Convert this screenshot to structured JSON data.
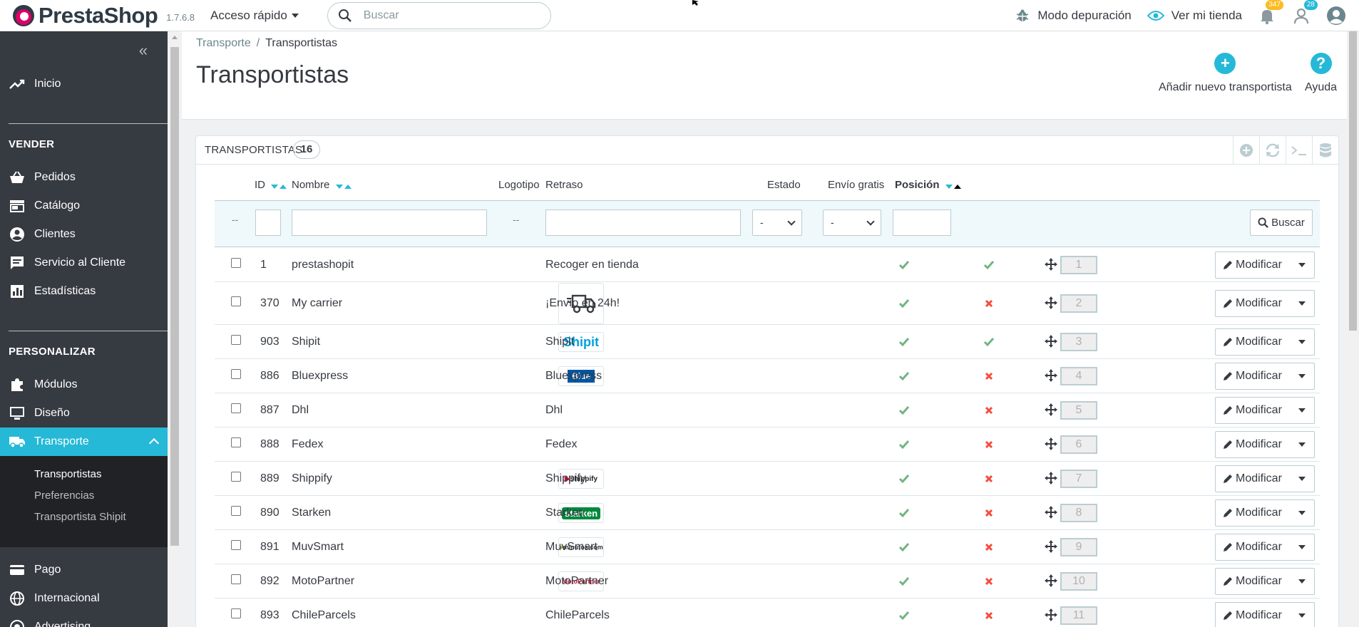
{
  "header": {
    "brand": "PrestaShop",
    "version": "1.7.6.8",
    "quick_access": "Acceso rápido",
    "search_placeholder": "Buscar",
    "debug_mode": "Modo depuración",
    "view_shop": "Ver mi tienda",
    "orders_badge": "347",
    "customers_badge": "28",
    "colors": {
      "accent": "#25b9d7",
      "orders_badge": "#fbbb22",
      "customers_badge": "#25b9d7"
    }
  },
  "sidebar": {
    "home": "Inicio",
    "section_sell": "VENDER",
    "sell_items": [
      "Pedidos",
      "Catálogo",
      "Clientes",
      "Servicio al Cliente",
      "Estadísticas"
    ],
    "section_customize": "PERSONALIZAR",
    "customize_items": [
      "Módulos",
      "Diseño",
      "Transporte"
    ],
    "transport_sub": [
      "Transportistas",
      "Preferencias",
      "Transportista Shipit"
    ],
    "more_items": [
      "Pago",
      "Internacional",
      "Advertising"
    ]
  },
  "page": {
    "breadcrumb_parent": "Transporte",
    "breadcrumb_current": "Transportistas",
    "title": "Transportistas",
    "add_button": "Añadir nuevo transportista",
    "help_button": "Ayuda"
  },
  "panel": {
    "title": "TRANSPORTISTAS",
    "count": "16"
  },
  "table": {
    "headers": {
      "id": "ID",
      "name": "Nombre",
      "logo": "Logotipo",
      "delay": "Retraso",
      "status": "Estado",
      "free": "Envío gratis",
      "position": "Posición"
    },
    "filters": {
      "dash": "--",
      "select_value": "-",
      "search_button": "Buscar"
    },
    "edit_label": "Modificar",
    "rows": [
      {
        "id": "1",
        "name": "prestashopit",
        "logo": "",
        "delay": "Recoger en tienda",
        "active": true,
        "free": true,
        "position": "1"
      },
      {
        "id": "370",
        "name": "My carrier",
        "logo": "truck",
        "delay": "¡Envío en 24h!",
        "active": true,
        "free": false,
        "position": "2"
      },
      {
        "id": "903",
        "name": "Shipit",
        "logo": "Shipit",
        "delay": "Shipit",
        "active": true,
        "free": true,
        "position": "3"
      },
      {
        "id": "886",
        "name": "Bluexpress",
        "logo": "Blue",
        "delay": "Bluexpress",
        "active": true,
        "free": false,
        "position": "4"
      },
      {
        "id": "887",
        "name": "Dhl",
        "logo": "",
        "delay": "Dhl",
        "active": true,
        "free": false,
        "position": "5"
      },
      {
        "id": "888",
        "name": "Fedex",
        "logo": "",
        "delay": "Fedex",
        "active": true,
        "free": false,
        "position": "6"
      },
      {
        "id": "889",
        "name": "Shippify",
        "logo": "shippify",
        "delay": "Shippify",
        "active": true,
        "free": false,
        "position": "7"
      },
      {
        "id": "890",
        "name": "Starken",
        "logo": "starken",
        "delay": "Starken",
        "active": true,
        "free": false,
        "position": "8"
      },
      {
        "id": "891",
        "name": "MuvSmart",
        "logo": "minutos.com",
        "delay": "MuvSmart",
        "active": true,
        "free": false,
        "position": "9"
      },
      {
        "id": "892",
        "name": "MotoPartner",
        "logo": "MotoPartner",
        "delay": "MotoPartner",
        "active": true,
        "free": false,
        "position": "10"
      },
      {
        "id": "893",
        "name": "ChileParcels",
        "logo": "",
        "delay": "ChileParcels",
        "active": true,
        "free": false,
        "position": "11"
      }
    ]
  }
}
